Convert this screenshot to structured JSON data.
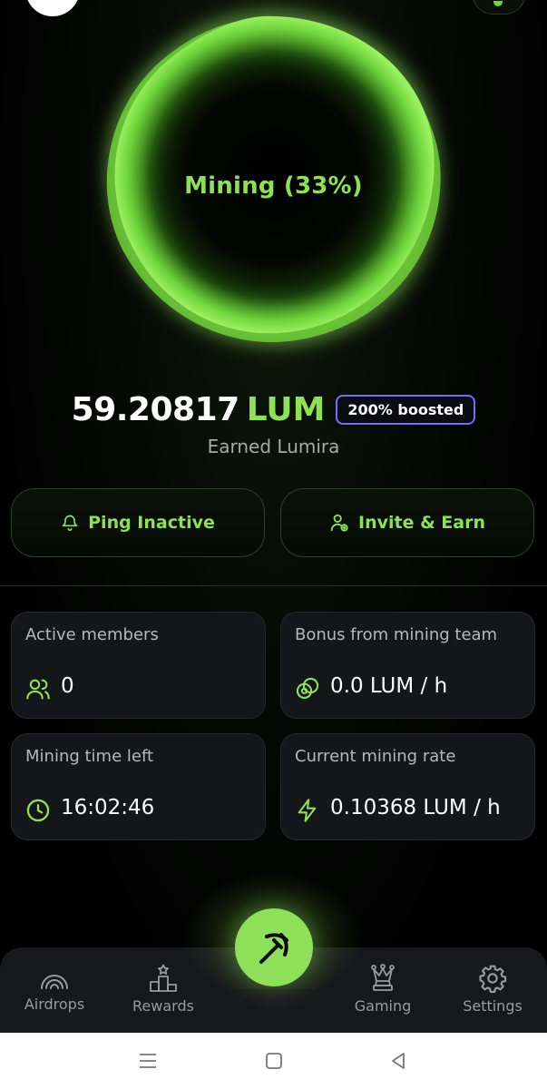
{
  "app": {
    "mining_status": "Mining (33%)",
    "mining_progress": 0.33,
    "accent_color": "#8ee05a",
    "boost_color": "#7b6cf0"
  },
  "balance": {
    "amount": "59.20817",
    "unit": "LUM",
    "boost_badge": "200% boosted",
    "label": "Earned Lumira"
  },
  "actions": {
    "ping": {
      "label": "Ping Inactive",
      "icon": "bell-icon"
    },
    "invite": {
      "label": "Invite & Earn",
      "icon": "user-plus-icon"
    }
  },
  "stats": {
    "active_members": {
      "title": "Active members",
      "value": "0",
      "icon": "users-icon"
    },
    "team_bonus": {
      "title": "Bonus from mining team",
      "value": "0.0 LUM / h",
      "icon": "coins-icon"
    },
    "time_left": {
      "title": "Mining time left",
      "value": "16:02:46",
      "icon": "clock-icon"
    },
    "mining_rate": {
      "title": "Current mining rate",
      "value": "0.10368 LUM / h",
      "icon": "lightning-icon"
    }
  },
  "nav": {
    "airdrops": {
      "label": "Airdrops",
      "icon": "broadcast-icon"
    },
    "rewards": {
      "label": "Rewards",
      "icon": "podium-icon"
    },
    "mine": {
      "icon": "pickaxe-icon"
    },
    "gaming": {
      "label": "Gaming",
      "icon": "chess-queen-icon"
    },
    "settings": {
      "label": "Settings",
      "icon": "gear-icon"
    }
  },
  "system_nav": {
    "recents": "menu-icon",
    "home": "square-icon",
    "back": "triangle-back-icon"
  }
}
